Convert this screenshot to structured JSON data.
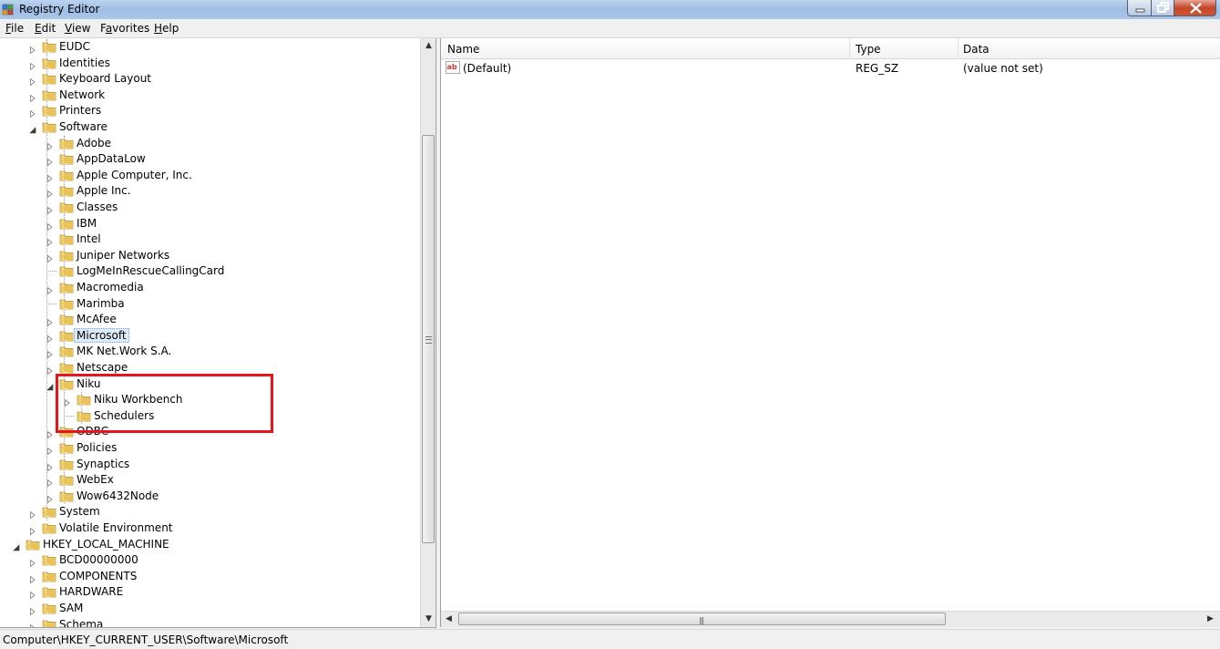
{
  "window": {
    "title": "Registry Editor"
  },
  "menu": [
    {
      "label": "File",
      "accel": "F",
      "rest": "ile"
    },
    {
      "label": "Edit",
      "accel": "E",
      "rest": "dit"
    },
    {
      "label": "View",
      "accel": "V",
      "rest": "iew"
    },
    {
      "label": "Favorites",
      "accel": "a",
      "pre": "F",
      "rest": "vorites"
    },
    {
      "label": "Help",
      "accel": "H",
      "rest": "elp"
    }
  ],
  "tree": [
    {
      "label": "EUDC",
      "level": 2,
      "expander": "collapsed"
    },
    {
      "label": "Identities",
      "level": 2,
      "expander": "collapsed"
    },
    {
      "label": "Keyboard Layout",
      "level": 2,
      "expander": "collapsed"
    },
    {
      "label": "Network",
      "level": 2,
      "expander": "collapsed"
    },
    {
      "label": "Printers",
      "level": 2,
      "expander": "collapsed"
    },
    {
      "label": "Software",
      "level": 2,
      "expander": "expanded"
    },
    {
      "label": "Adobe",
      "level": 3,
      "expander": "collapsed"
    },
    {
      "label": "AppDataLow",
      "level": 3,
      "expander": "collapsed"
    },
    {
      "label": "Apple Computer, Inc.",
      "level": 3,
      "expander": "collapsed"
    },
    {
      "label": "Apple Inc.",
      "level": 3,
      "expander": "collapsed"
    },
    {
      "label": "Classes",
      "level": 3,
      "expander": "collapsed"
    },
    {
      "label": "IBM",
      "level": 3,
      "expander": "collapsed"
    },
    {
      "label": "Intel",
      "level": 3,
      "expander": "collapsed"
    },
    {
      "label": "Juniper Networks",
      "level": 3,
      "expander": "collapsed"
    },
    {
      "label": "LogMeInRescueCallingCard",
      "level": 3,
      "expander": "none"
    },
    {
      "label": "Macromedia",
      "level": 3,
      "expander": "collapsed"
    },
    {
      "label": "Marimba",
      "level": 3,
      "expander": "none"
    },
    {
      "label": "McAfee",
      "level": 3,
      "expander": "collapsed"
    },
    {
      "label": "Microsoft",
      "level": 3,
      "expander": "collapsed",
      "selected": true
    },
    {
      "label": "MK Net.Work S.A.",
      "level": 3,
      "expander": "collapsed"
    },
    {
      "label": "Netscape",
      "level": 3,
      "expander": "collapsed"
    },
    {
      "label": "Niku",
      "level": 3,
      "expander": "expanded"
    },
    {
      "label": "Niku Workbench",
      "level": 4,
      "expander": "collapsed"
    },
    {
      "label": "Schedulers",
      "level": 4,
      "expander": "none"
    },
    {
      "label": "ODBC",
      "level": 3,
      "expander": "collapsed"
    },
    {
      "label": "Policies",
      "level": 3,
      "expander": "collapsed"
    },
    {
      "label": "Synaptics",
      "level": 3,
      "expander": "collapsed"
    },
    {
      "label": "WebEx",
      "level": 3,
      "expander": "collapsed"
    },
    {
      "label": "Wow6432Node",
      "level": 3,
      "expander": "collapsed"
    },
    {
      "label": "System",
      "level": 2,
      "expander": "collapsed"
    },
    {
      "label": "Volatile Environment",
      "level": 2,
      "expander": "collapsed"
    },
    {
      "label": "HKEY_LOCAL_MACHINE",
      "level": 1,
      "expander": "expanded"
    },
    {
      "label": "BCD00000000",
      "level": 2,
      "expander": "collapsed"
    },
    {
      "label": "COMPONENTS",
      "level": 2,
      "expander": "collapsed"
    },
    {
      "label": "HARDWARE",
      "level": 2,
      "expander": "collapsed"
    },
    {
      "label": "SAM",
      "level": 2,
      "expander": "collapsed"
    },
    {
      "label": "Schema",
      "level": 2,
      "expander": "collapsed"
    }
  ],
  "list": {
    "columns": [
      "Name",
      "Type",
      "Data"
    ],
    "rows": [
      {
        "icon": "reg-string-icon",
        "name": "(Default)",
        "type": "REG_SZ",
        "data": "(value not set)"
      }
    ]
  },
  "status": {
    "path": "Computer\\HKEY_CURRENT_USER\\Software\\Microsoft"
  },
  "colors": {
    "highlight": "#e8141c",
    "selection": "#ddebfa",
    "folder": "#e8c35a"
  }
}
